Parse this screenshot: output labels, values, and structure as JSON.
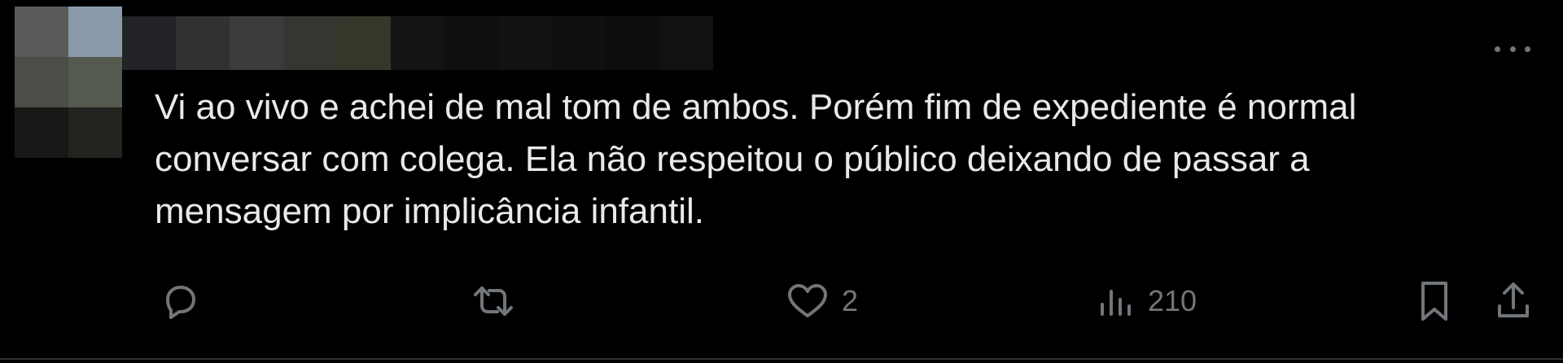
{
  "tweet": {
    "text": "Vi ao vivo e achei de mal tom de ambos. Porém fim de expediente é normal\nconversar com colega. Ela não respeitou o público deixando de passar a\nmensagem por implicância infantil.",
    "more_icon": "ellipsis-icon"
  },
  "avatar": {
    "pixels": [
      "#5a5a5a",
      "#8a9aab",
      "#4a4e47",
      "#545a4e",
      "#171715",
      "#22221f"
    ]
  },
  "author": {
    "pixels": [
      "#222326",
      "#2f3133",
      "#3a3c3c",
      "#35362f",
      "#36372a",
      "#141414",
      "#0f0f10",
      "#121212",
      "#101011",
      "#0d0d0e",
      "#111112"
    ]
  },
  "actions": {
    "reply": {
      "icon": "reply-icon"
    },
    "retweet": {
      "icon": "retweet-icon"
    },
    "like": {
      "icon": "heart-icon",
      "count": "2"
    },
    "views": {
      "icon": "views-chart-icon",
      "count": "210"
    },
    "bookmark": {
      "icon": "bookmark-icon"
    },
    "share": {
      "icon": "share-icon"
    }
  },
  "colors": {
    "background": "#000000",
    "text": "#e7e9ea",
    "secondary": "#71767b",
    "divider": "#2f3336"
  }
}
